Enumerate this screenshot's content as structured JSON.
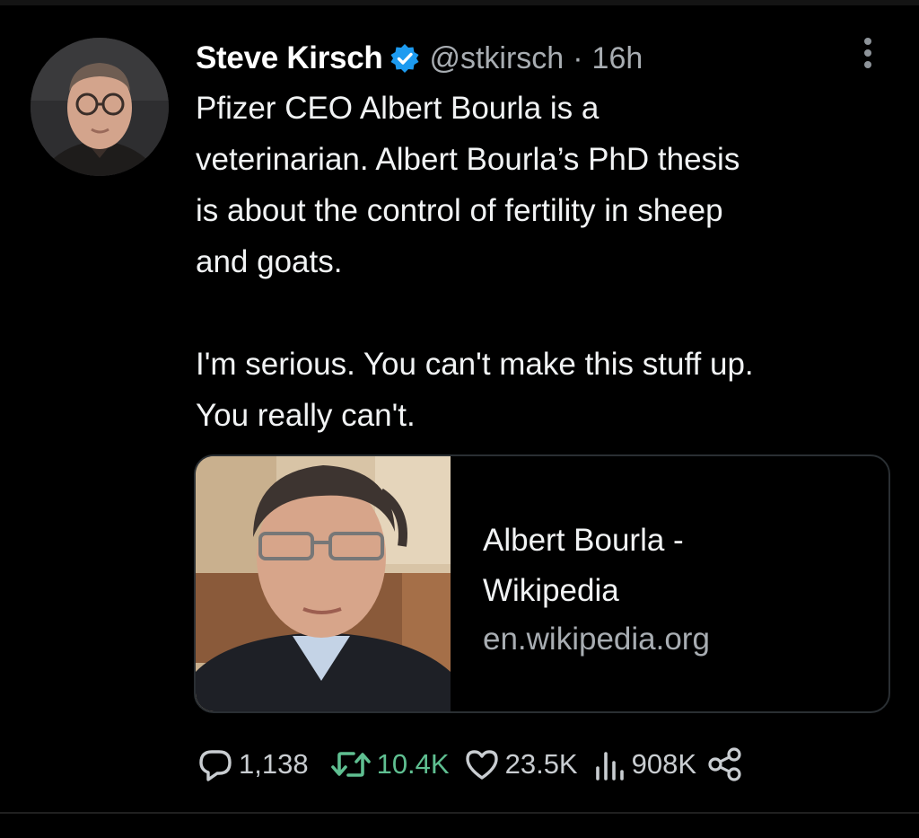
{
  "tweet": {
    "author": {
      "name": "Steve Kirsch",
      "handle": "@stkirsch",
      "verified": true,
      "avatar_icon": "profile-photo"
    },
    "separator": "·",
    "time": "16h",
    "menu_icon": "more-vertical-icon",
    "text_lines": [
      "Pfizer CEO Albert Bourla is a",
      "veterinarian. Albert Bourla’s PhD thesis",
      "is about the control of fertility in sheep",
      "and goats.",
      "I'm serious. You can't make this stuff up.",
      "You really can't."
    ],
    "link_card": {
      "title_line1": "Albert Bourla -",
      "title_line2": "Wikipedia",
      "domain": "en.wikipedia.org",
      "image_icon": "person-photo"
    },
    "actions": {
      "replies": "1,138",
      "retweets": "10.4K",
      "likes": "23.5K",
      "views": "908K"
    }
  },
  "colors": {
    "background": "#000000",
    "text": "#e7e9ea",
    "secondary_text": "#a8adb2",
    "verified_blue": "#1d9bf0",
    "retweet_green": "#5fbf91",
    "card_border": "#2a2f33"
  }
}
